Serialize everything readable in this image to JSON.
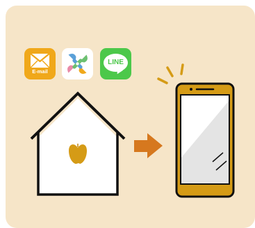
{
  "apps": {
    "email": {
      "label": "E-mail",
      "icon": "email-envelope-icon",
      "color": "#f0a81a"
    },
    "pinwheel": {
      "icon": "pinwheel-app-icon",
      "colors": [
        "#5aa0d8",
        "#6cc070",
        "#e88aa8",
        "#f0a81a"
      ]
    },
    "line": {
      "label": "LINE",
      "icon": "line-chat-icon",
      "color": "#4cc84a"
    }
  },
  "scene": {
    "house_icon": "house-icon",
    "apple_icon": "apple-icon",
    "arrow_icon": "right-arrow-icon",
    "phone_icon": "smartphone-icon",
    "accent_color": "#d59b16",
    "arrow_color": "#d6781e",
    "background_color": "#f6e5c8"
  }
}
